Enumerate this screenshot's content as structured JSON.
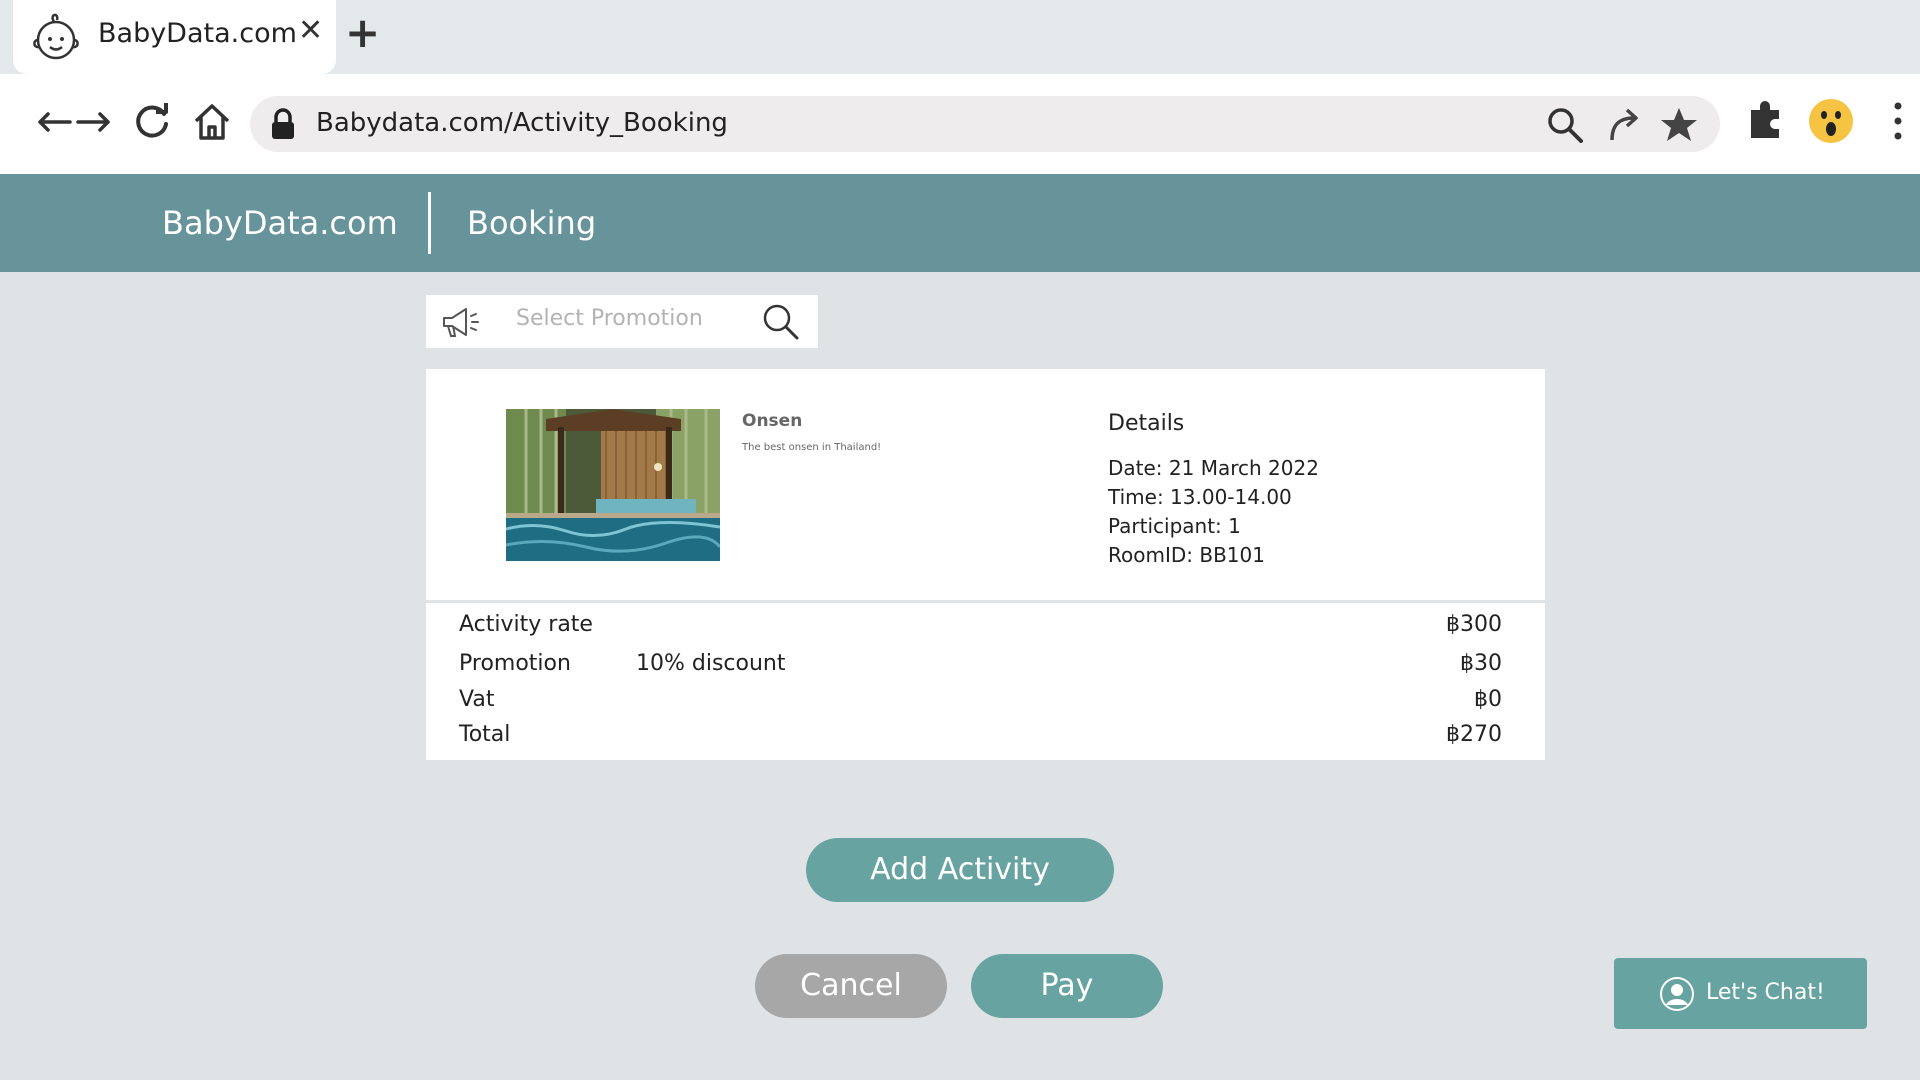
{
  "browser": {
    "tab_title": "BabyData.com",
    "tab_close": "✕",
    "new_tab": "+",
    "url": "Babydata.com/Activity_Booking"
  },
  "header": {
    "brand": "BabyData.com",
    "page_title": "Booking"
  },
  "promotion": {
    "placeholder": "Select Promotion"
  },
  "activity": {
    "name": "Onsen",
    "description": "The best onsen in Thailand!"
  },
  "details": {
    "title": "Details",
    "date": "Date: 21 March 2022",
    "time": "Time: 13.00-14.00",
    "participant": "Participant: 1",
    "room": "RoomID: BB101"
  },
  "prices": {
    "rate_label": "Activity rate",
    "rate_value": "฿300",
    "promo_label": "Promotion",
    "promo_note": "10% discount",
    "promo_value": "฿30",
    "vat_label": "Vat",
    "vat_value": "฿0",
    "total_label": "Total",
    "total_value": "฿270"
  },
  "actions": {
    "add_activity": "Add Activity",
    "cancel": "Cancel",
    "pay": "Pay"
  },
  "chat": {
    "label": "Let's Chat!"
  },
  "colors": {
    "header_bg": "#67939b",
    "button_teal": "#67a3a1",
    "button_grey": "#a7a7a7",
    "page_bg": "#dfe3e6"
  }
}
